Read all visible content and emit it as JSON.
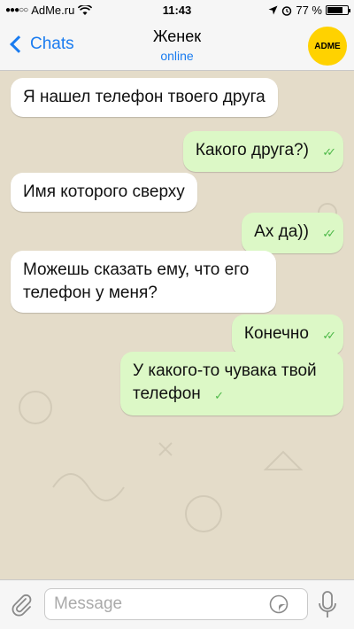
{
  "status_bar": {
    "carrier": "AdMe.ru",
    "time": "11:43",
    "battery": "77 %"
  },
  "header": {
    "back_label": "Chats",
    "contact_name": "Женек",
    "contact_status": "online",
    "avatar_text": "ADME"
  },
  "messages": [
    {
      "direction": "incoming",
      "text": "Я нашел телефон твоего друга"
    },
    {
      "direction": "outgoing",
      "text": "Какого друга?)",
      "ticks": "✓✓"
    },
    {
      "direction": "incoming",
      "text": "Имя которого сверху"
    },
    {
      "direction": "outgoing",
      "text": "Ах да))",
      "ticks": "✓✓"
    },
    {
      "direction": "incoming",
      "text": "Можешь сказать ему, что его телефон у меня?"
    },
    {
      "direction": "outgoing",
      "text": "Конечно",
      "ticks": "✓✓"
    },
    {
      "direction": "outgoing",
      "text": "У какого-то чувака твой телефон",
      "ticks": "✓"
    }
  ],
  "input": {
    "placeholder": "Message",
    "value": ""
  },
  "colors": {
    "accent": "#1a7cf0",
    "outgoing_bubble": "#dcf8c6",
    "incoming_bubble": "#ffffff",
    "tick": "#4fb94a",
    "avatar": "#ffd200"
  },
  "icons": [
    "wifi-icon",
    "location-icon",
    "alarm-icon",
    "battery-icon",
    "back-chevron-icon",
    "paperclip-icon",
    "sticker-icon",
    "microphone-icon"
  ]
}
